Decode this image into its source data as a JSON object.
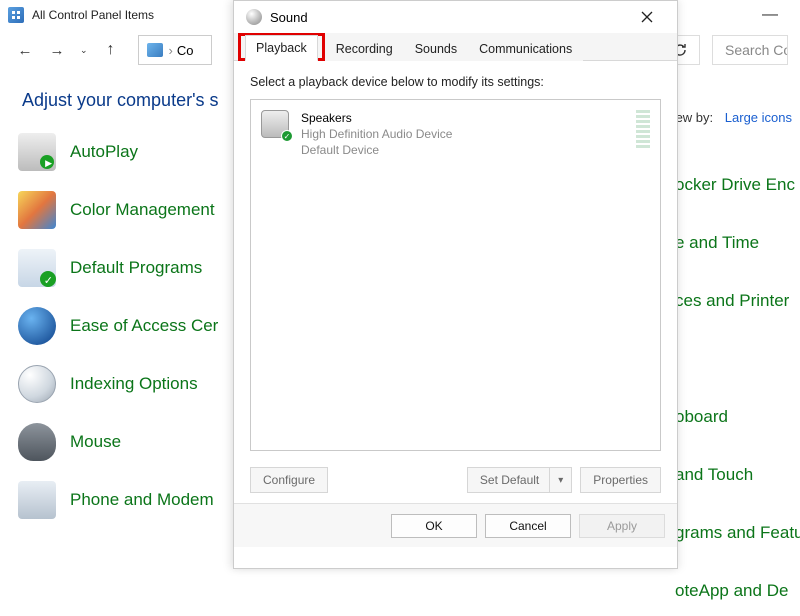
{
  "cp": {
    "title": "All Control Panel Items",
    "breadcrumb": "Co",
    "search_placeholder": "Search Co",
    "heading": "Adjust your computer's s",
    "viewby_label": "ew by:",
    "viewby_value": "Large icons",
    "items_left": [
      "AutoPlay",
      "Color Management",
      "Default Programs",
      "Ease of Access Cer",
      "Indexing Options",
      "Mouse",
      "Phone and Modem"
    ],
    "items_right": [
      "ocker Drive Enc",
      "e and Time",
      "ces and Printer",
      "",
      "oboard",
      "and Touch",
      "grams and Featu",
      "oteApp and De"
    ]
  },
  "snd": {
    "title": "Sound",
    "tabs": {
      "playback": "Playback",
      "recording": "Recording",
      "sounds": "Sounds",
      "communications": "Communications"
    },
    "instruction": "Select a playback device below to modify its settings:",
    "device": {
      "name": "Speakers",
      "driver": "High Definition Audio Device",
      "status": "Default Device"
    },
    "btn_configure": "Configure",
    "btn_setdefault": "Set Default",
    "btn_properties": "Properties",
    "btn_ok": "OK",
    "btn_cancel": "Cancel",
    "btn_apply": "Apply"
  }
}
